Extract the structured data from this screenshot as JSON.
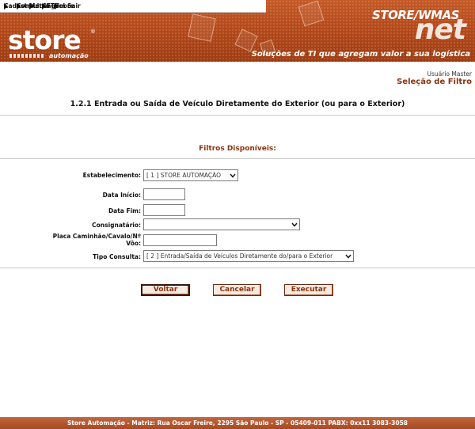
{
  "menu": [
    {
      "label": "Cadastro"
    },
    {
      "label": "Consultas"
    },
    {
      "label": "Mensagem"
    },
    {
      "label": "CFTV"
    },
    {
      "label": "Sobre"
    },
    {
      "label": "Sair"
    }
  ],
  "header": {
    "logo_text": "store",
    "logo_sub": "automação",
    "brand_top": "STORE/WMAS",
    "brand_big": "net",
    "tagline": "Soluções de TI que agregam valor a sua logística"
  },
  "user_label": "Usuário Master",
  "page_subtitle": "Seleção de Filtro",
  "page_title": "1.2.1 Entrada ou Saída de Veículo Diretamente do Exterior (ou para o Exterior)",
  "filters_title": "Filtros Disponíveis:",
  "form": {
    "estabelecimento": {
      "label": "Estabelecimento:",
      "value": "[ 1 ] STORE AUTOMAÇÃO"
    },
    "data_inicio": {
      "label": "Data Início:",
      "value": ""
    },
    "data_fim": {
      "label": "Data Fim:",
      "value": ""
    },
    "consignatario": {
      "label": "Consignatário:",
      "value": ""
    },
    "placa_line1": "Placa Caminhão/Cavalo/Nº",
    "placa_line2": "Vôo:",
    "placa_value": "",
    "tipo_consulta": {
      "label": "Tipo Consulta:",
      "value": "[ 2 ] Entrada/Saída de Veículos Diretamente do/para o Exterior"
    }
  },
  "buttons": {
    "voltar": "Voltar",
    "cancelar": "Cancelar",
    "executar": "Executar"
  },
  "footer": "Store Automação - Matriz: Rua Oscar Freire, 2295 São Paulo - SP - 05409-011 PABX: 0xx11 3083-3058",
  "colors": {
    "brand": "#b44a1c",
    "accent_text": "#8b3412",
    "button_bg": "#f6e9df"
  }
}
